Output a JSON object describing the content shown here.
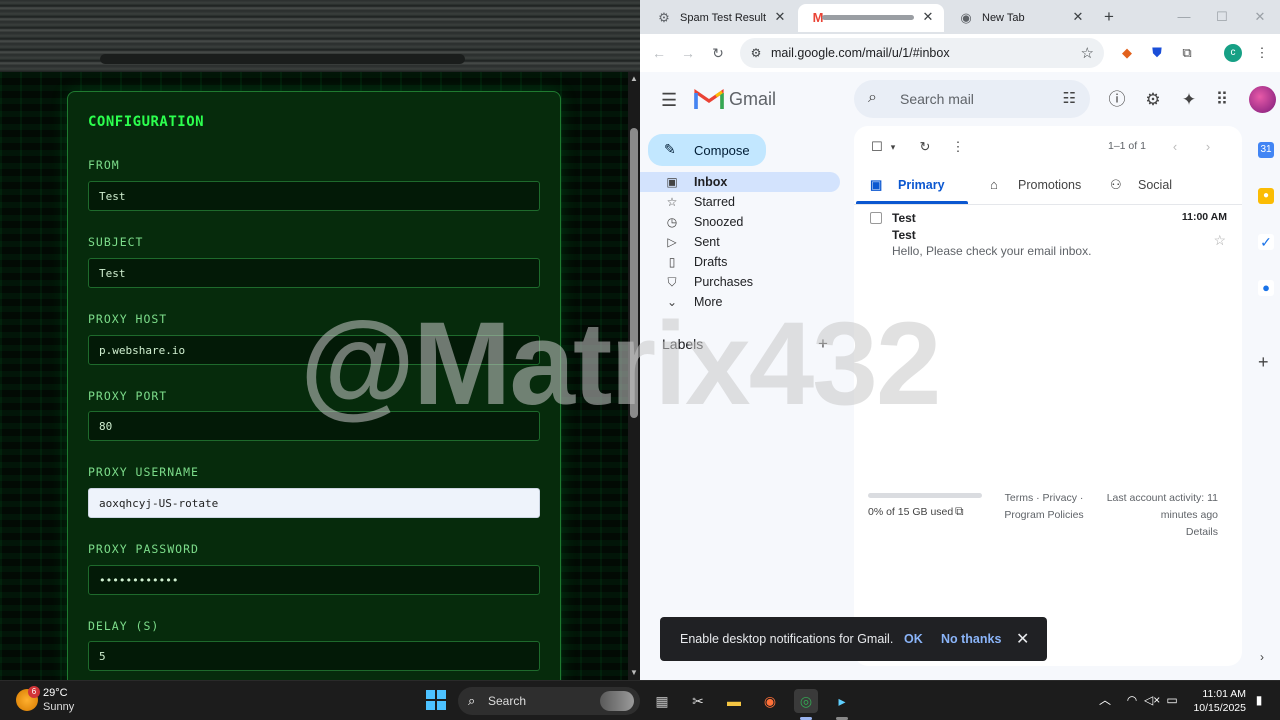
{
  "config": {
    "title": "CONFIGURATION",
    "fields": [
      {
        "label": "FROM",
        "value": "Test"
      },
      {
        "label": "SUBJECT",
        "value": "Test"
      },
      {
        "label": "PROXY HOST",
        "value": "p.webshare.io"
      },
      {
        "label": "PROXY PORT",
        "value": "80"
      },
      {
        "label": "PROXY USERNAME",
        "value": "aoxqhcyj-US-rotate"
      },
      {
        "label": "PROXY PASSWORD",
        "value": "••••••••••••"
      },
      {
        "label": "DELAY (S)",
        "value": "5"
      }
    ]
  },
  "watermark": "@Matrix432",
  "browser": {
    "tabs": [
      {
        "title": "Spam Test Result",
        "icon": "gear-icon"
      },
      {
        "title": "",
        "icon": "gmail-icon"
      },
      {
        "title": "New Tab",
        "icon": "chrome-icon"
      }
    ],
    "url": "mail.google.com/mail/u/1/#inbox",
    "profile_initial": "c"
  },
  "gmail": {
    "logo_text": "Gmail",
    "search_placeholder": "Search mail",
    "compose": "Compose",
    "nav": [
      {
        "label": "Inbox",
        "icon": "inbox-icon"
      },
      {
        "label": "Starred",
        "icon": "star-icon"
      },
      {
        "label": "Snoozed",
        "icon": "clock-icon"
      },
      {
        "label": "Sent",
        "icon": "send-icon"
      },
      {
        "label": "Drafts",
        "icon": "draft-icon"
      },
      {
        "label": "Purchases",
        "icon": "bag-icon"
      },
      {
        "label": "More",
        "icon": "chevron-down-icon"
      }
    ],
    "labels_heading": "Labels",
    "pagination": "1–1 of 1",
    "tabs": [
      {
        "label": "Primary",
        "icon": "inbox-icon"
      },
      {
        "label": "Promotions",
        "icon": "tag-icon"
      },
      {
        "label": "Social",
        "icon": "people-icon"
      }
    ],
    "email": {
      "sender": "Test",
      "subject": "Test",
      "snippet": "Hello, Please check your email inbox.",
      "time": "11:00 AM"
    },
    "storage": "0% of 15 GB used",
    "footer_links": "Terms · Privacy · Program Policies",
    "last_activity": "Last account activity: 11 minutes ago",
    "details": "Details",
    "snackbar": {
      "text": "Enable desktop notifications for Gmail.",
      "ok": "OK",
      "no": "No thanks"
    }
  },
  "taskbar": {
    "weather_badge": "6",
    "temp": "29°C",
    "condition": "Sunny",
    "search": "Search",
    "time": "11:01 AM",
    "date": "10/15/2025"
  }
}
